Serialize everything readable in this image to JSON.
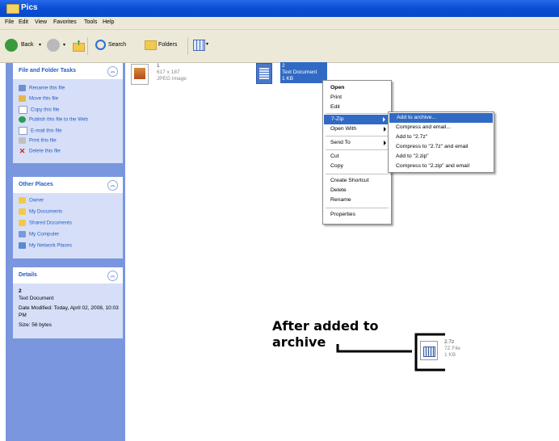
{
  "window": {
    "title": "Pics"
  },
  "menu": [
    "File",
    "Edit",
    "View",
    "Favorites",
    "Tools",
    "Help"
  ],
  "toolbar": {
    "back": "Back",
    "search": "Search",
    "folders": "Folders"
  },
  "tasks": {
    "title": "File and Folder Tasks",
    "items": [
      "Rename this file",
      "Move this file",
      "Copy this file",
      "Publish this file to the Web",
      "E-mail this file",
      "Print this file",
      "Delete this file"
    ]
  },
  "other_places": {
    "title": "Other Places",
    "items": [
      "Owner",
      "My Documents",
      "Shared Documents",
      "My Computer",
      "My Network Places"
    ]
  },
  "details": {
    "title": "Details",
    "name": "2",
    "type": "Text Document",
    "modified": "Date Modified: Today, April 02, 2008, 10:03 PM",
    "size": "Size: 56 bytes"
  },
  "files": [
    {
      "name": "1",
      "line2": "617 x 187",
      "line3": "JPEG Image"
    },
    {
      "name": "2",
      "line2": "Text Document",
      "line3": "1 KB"
    }
  ],
  "context_menu": {
    "items": [
      "Open",
      "Print",
      "Edit",
      "7-Zip",
      "Open With",
      "Send To",
      "Cut",
      "Copy",
      "Create Shortcut",
      "Delete",
      "Rename",
      "Properties"
    ]
  },
  "submenu": {
    "items": [
      "Add to archive...",
      "Compress and email...",
      "Add to \"2.7z\"",
      "Compress to \"2.7z\" and email",
      "Add to \"2.zip\"",
      "Compress to \"2.zip\" and email"
    ]
  },
  "annotation": {
    "line1": "After added to",
    "line2": "archive"
  },
  "archive_file": {
    "name": "2.7z",
    "type": "7Z File",
    "size": "1 KB"
  }
}
